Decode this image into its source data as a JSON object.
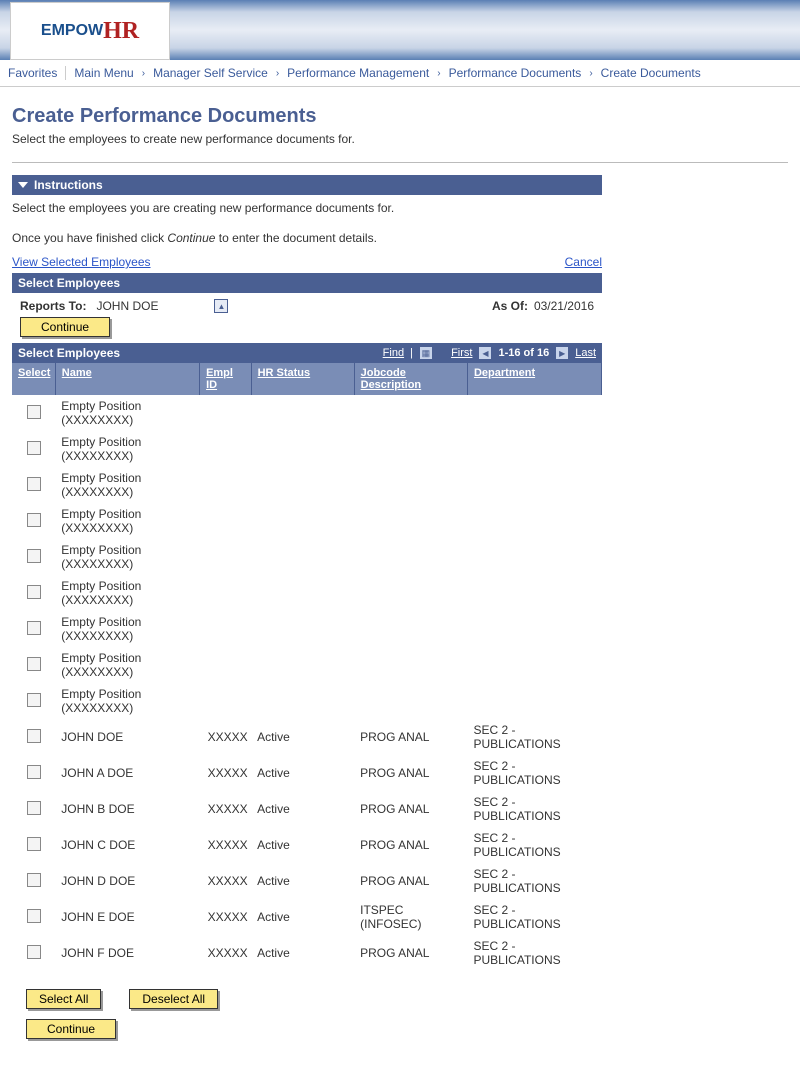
{
  "logo": {
    "text1": "EMPOW",
    "text2": "HR"
  },
  "breadcrumb": {
    "favorites": "Favorites",
    "main_menu": "Main Menu",
    "items": [
      "Manager Self Service",
      "Performance Management",
      "Performance Documents",
      "Create Documents"
    ]
  },
  "page": {
    "title": "Create Performance Documents",
    "subtitle": "Select the employees to create new performance documents for."
  },
  "instructions": {
    "header": "Instructions",
    "line1": "Select the employees you are creating new performance documents for.",
    "line2a": "Once you have finished click ",
    "line2b": "Continue",
    "line2c": " to enter the document details."
  },
  "links": {
    "view_selected": "View Selected Employees",
    "cancel": "Cancel"
  },
  "select_employees": {
    "header": "Select Employees",
    "reports_to_label": "Reports To:",
    "reports_to_value": "JOHN DOE",
    "as_of_label": "As Of:",
    "as_of_value": "03/21/2016",
    "continue_btn": "Continue"
  },
  "grid": {
    "title": "Select Employees",
    "find": "Find",
    "first": "First",
    "range": "1-16 of 16",
    "last": "Last",
    "columns": {
      "select": "Select",
      "name": "Name",
      "empl_id": "Empl ID",
      "hr_status": "HR Status",
      "jobcode": "Jobcode Description",
      "department": "Department"
    },
    "rows": [
      {
        "name": "Empty Position (XXXXXXXX)",
        "empl_id": "",
        "hr_status": "",
        "jobcode": "",
        "department": ""
      },
      {
        "name": "Empty Position (XXXXXXXX)",
        "empl_id": "",
        "hr_status": "",
        "jobcode": "",
        "department": ""
      },
      {
        "name": "Empty Position (XXXXXXXX)",
        "empl_id": "",
        "hr_status": "",
        "jobcode": "",
        "department": ""
      },
      {
        "name": "Empty Position (XXXXXXXX)",
        "empl_id": "",
        "hr_status": "",
        "jobcode": "",
        "department": ""
      },
      {
        "name": "Empty Position (XXXXXXXX)",
        "empl_id": "",
        "hr_status": "",
        "jobcode": "",
        "department": ""
      },
      {
        "name": "Empty Position (XXXXXXXX)",
        "empl_id": "",
        "hr_status": "",
        "jobcode": "",
        "department": ""
      },
      {
        "name": "Empty Position (XXXXXXXX)",
        "empl_id": "",
        "hr_status": "",
        "jobcode": "",
        "department": ""
      },
      {
        "name": "Empty Position (XXXXXXXX)",
        "empl_id": "",
        "hr_status": "",
        "jobcode": "",
        "department": ""
      },
      {
        "name": "Empty Position (XXXXXXXX)",
        "empl_id": "",
        "hr_status": "",
        "jobcode": "",
        "department": ""
      },
      {
        "name": "JOHN DOE",
        "empl_id": "XXXXX",
        "hr_status": "Active",
        "jobcode": "PROG ANAL",
        "department": "SEC 2 - PUBLICATIONS"
      },
      {
        "name": "JOHN A DOE",
        "empl_id": "XXXXX",
        "hr_status": "Active",
        "jobcode": "PROG ANAL",
        "department": "SEC 2 - PUBLICATIONS"
      },
      {
        "name": "JOHN B DOE",
        "empl_id": "XXXXX",
        "hr_status": "Active",
        "jobcode": "PROG ANAL",
        "department": "SEC 2 - PUBLICATIONS"
      },
      {
        "name": "JOHN C DOE",
        "empl_id": "XXXXX",
        "hr_status": "Active",
        "jobcode": "PROG ANAL",
        "department": "SEC 2 - PUBLICATIONS"
      },
      {
        "name": "JOHN D DOE",
        "empl_id": "XXXXX",
        "hr_status": "Active",
        "jobcode": "PROG ANAL",
        "department": "SEC 2 - PUBLICATIONS"
      },
      {
        "name": "JOHN E DOE",
        "empl_id": "XXXXX",
        "hr_status": "Active",
        "jobcode": "ITSPEC (INFOSEC)",
        "department": "SEC 2 - PUBLICATIONS"
      },
      {
        "name": "JOHN F DOE",
        "empl_id": "XXXXX",
        "hr_status": "Active",
        "jobcode": "PROG ANAL",
        "department": "SEC 2 - PUBLICATIONS"
      }
    ]
  },
  "buttons": {
    "select_all": "Select All",
    "deselect_all": "Deselect All",
    "continue": "Continue"
  }
}
